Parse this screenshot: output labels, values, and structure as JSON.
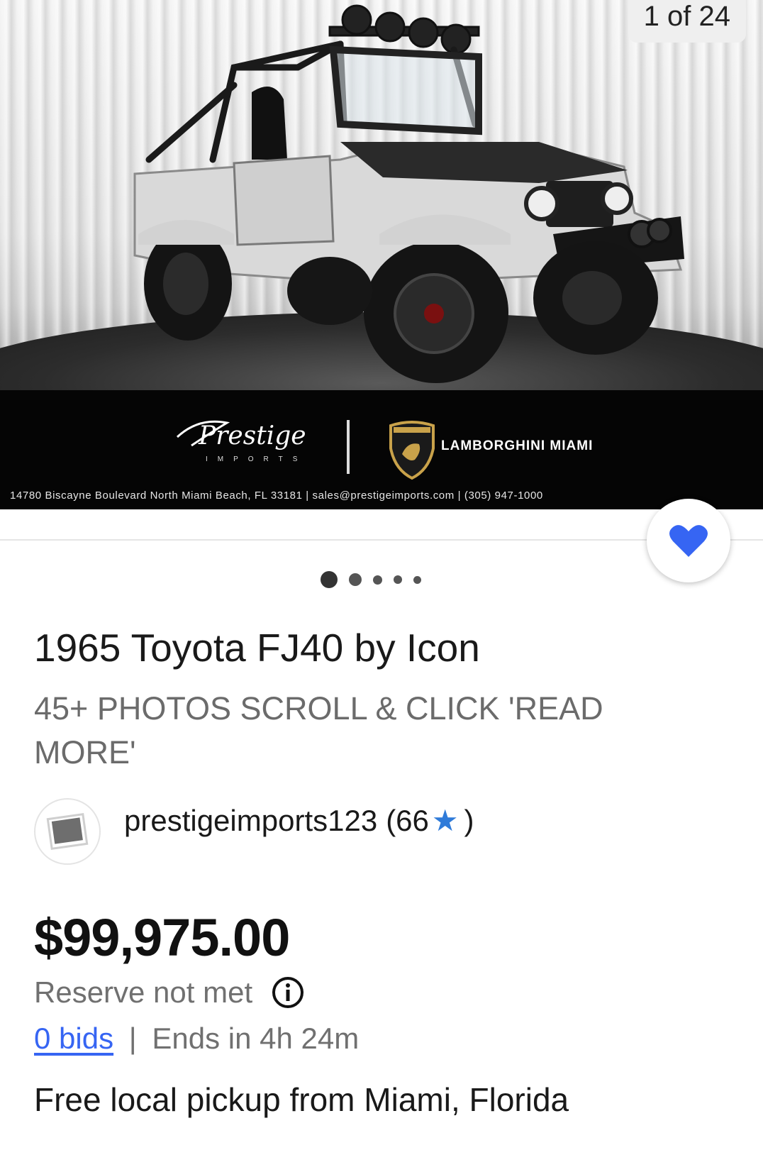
{
  "gallery": {
    "counter": "1 of 24",
    "dealer": {
      "logo_text": "Prestige",
      "logo_sub": "IMPORTS",
      "brand": "LAMBORGHINI MIAMI",
      "address": "14780 Biscayne Boulevard North Miami Beach, FL 33181 | sales@prestigeimports.com | (305) 947-1000"
    },
    "dots": 5,
    "active_dot": 1
  },
  "listing": {
    "title": "1965 Toyota FJ40 by Icon",
    "subtitle": "45+ PHOTOS SCROLL & CLICK 'READ MORE'",
    "seller": {
      "name": "prestigeimports123",
      "feedback_open": "(66",
      "feedback_close": ")"
    },
    "price": "$99,975.00",
    "reserve": "Reserve not met",
    "bids_link": "0 bids",
    "separator": "|",
    "ends": "Ends in 4h 24m",
    "shipping": "Free local pickup from Miami, Florida"
  },
  "colors": {
    "accent": "#3665f3",
    "star": "#2f7bd9",
    "heart": "#3665f3"
  },
  "icons": {
    "watch": "heart-icon",
    "info": "info-icon",
    "star": "star-icon",
    "avatar": "photo-placeholder-icon"
  }
}
